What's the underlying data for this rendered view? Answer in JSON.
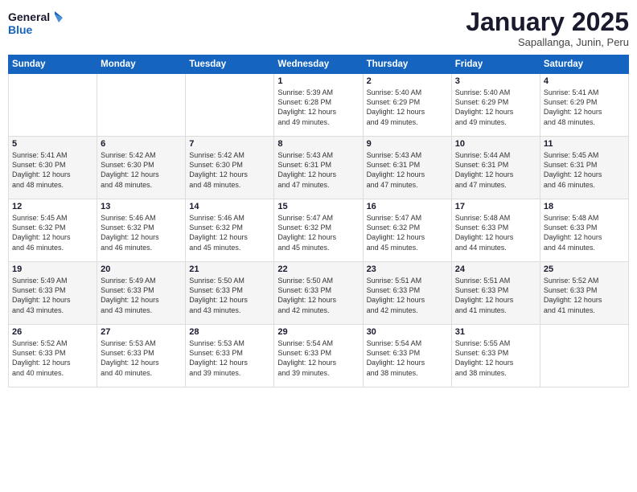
{
  "logo": {
    "line1": "General",
    "line2": "Blue"
  },
  "header": {
    "month": "January 2025",
    "location": "Sapallanga, Junin, Peru"
  },
  "weekdays": [
    "Sunday",
    "Monday",
    "Tuesday",
    "Wednesday",
    "Thursday",
    "Friday",
    "Saturday"
  ],
  "weeks": [
    [
      {
        "day": "",
        "info": ""
      },
      {
        "day": "",
        "info": ""
      },
      {
        "day": "",
        "info": ""
      },
      {
        "day": "1",
        "info": "Sunrise: 5:39 AM\nSunset: 6:28 PM\nDaylight: 12 hours\nand 49 minutes."
      },
      {
        "day": "2",
        "info": "Sunrise: 5:40 AM\nSunset: 6:29 PM\nDaylight: 12 hours\nand 49 minutes."
      },
      {
        "day": "3",
        "info": "Sunrise: 5:40 AM\nSunset: 6:29 PM\nDaylight: 12 hours\nand 49 minutes."
      },
      {
        "day": "4",
        "info": "Sunrise: 5:41 AM\nSunset: 6:29 PM\nDaylight: 12 hours\nand 48 minutes."
      }
    ],
    [
      {
        "day": "5",
        "info": "Sunrise: 5:41 AM\nSunset: 6:30 PM\nDaylight: 12 hours\nand 48 minutes."
      },
      {
        "day": "6",
        "info": "Sunrise: 5:42 AM\nSunset: 6:30 PM\nDaylight: 12 hours\nand 48 minutes."
      },
      {
        "day": "7",
        "info": "Sunrise: 5:42 AM\nSunset: 6:30 PM\nDaylight: 12 hours\nand 48 minutes."
      },
      {
        "day": "8",
        "info": "Sunrise: 5:43 AM\nSunset: 6:31 PM\nDaylight: 12 hours\nand 47 minutes."
      },
      {
        "day": "9",
        "info": "Sunrise: 5:43 AM\nSunset: 6:31 PM\nDaylight: 12 hours\nand 47 minutes."
      },
      {
        "day": "10",
        "info": "Sunrise: 5:44 AM\nSunset: 6:31 PM\nDaylight: 12 hours\nand 47 minutes."
      },
      {
        "day": "11",
        "info": "Sunrise: 5:45 AM\nSunset: 6:31 PM\nDaylight: 12 hours\nand 46 minutes."
      }
    ],
    [
      {
        "day": "12",
        "info": "Sunrise: 5:45 AM\nSunset: 6:32 PM\nDaylight: 12 hours\nand 46 minutes."
      },
      {
        "day": "13",
        "info": "Sunrise: 5:46 AM\nSunset: 6:32 PM\nDaylight: 12 hours\nand 46 minutes."
      },
      {
        "day": "14",
        "info": "Sunrise: 5:46 AM\nSunset: 6:32 PM\nDaylight: 12 hours\nand 45 minutes."
      },
      {
        "day": "15",
        "info": "Sunrise: 5:47 AM\nSunset: 6:32 PM\nDaylight: 12 hours\nand 45 minutes."
      },
      {
        "day": "16",
        "info": "Sunrise: 5:47 AM\nSunset: 6:32 PM\nDaylight: 12 hours\nand 45 minutes."
      },
      {
        "day": "17",
        "info": "Sunrise: 5:48 AM\nSunset: 6:33 PM\nDaylight: 12 hours\nand 44 minutes."
      },
      {
        "day": "18",
        "info": "Sunrise: 5:48 AM\nSunset: 6:33 PM\nDaylight: 12 hours\nand 44 minutes."
      }
    ],
    [
      {
        "day": "19",
        "info": "Sunrise: 5:49 AM\nSunset: 6:33 PM\nDaylight: 12 hours\nand 43 minutes."
      },
      {
        "day": "20",
        "info": "Sunrise: 5:49 AM\nSunset: 6:33 PM\nDaylight: 12 hours\nand 43 minutes."
      },
      {
        "day": "21",
        "info": "Sunrise: 5:50 AM\nSunset: 6:33 PM\nDaylight: 12 hours\nand 43 minutes."
      },
      {
        "day": "22",
        "info": "Sunrise: 5:50 AM\nSunset: 6:33 PM\nDaylight: 12 hours\nand 42 minutes."
      },
      {
        "day": "23",
        "info": "Sunrise: 5:51 AM\nSunset: 6:33 PM\nDaylight: 12 hours\nand 42 minutes."
      },
      {
        "day": "24",
        "info": "Sunrise: 5:51 AM\nSunset: 6:33 PM\nDaylight: 12 hours\nand 41 minutes."
      },
      {
        "day": "25",
        "info": "Sunrise: 5:52 AM\nSunset: 6:33 PM\nDaylight: 12 hours\nand 41 minutes."
      }
    ],
    [
      {
        "day": "26",
        "info": "Sunrise: 5:52 AM\nSunset: 6:33 PM\nDaylight: 12 hours\nand 40 minutes."
      },
      {
        "day": "27",
        "info": "Sunrise: 5:53 AM\nSunset: 6:33 PM\nDaylight: 12 hours\nand 40 minutes."
      },
      {
        "day": "28",
        "info": "Sunrise: 5:53 AM\nSunset: 6:33 PM\nDaylight: 12 hours\nand 39 minutes."
      },
      {
        "day": "29",
        "info": "Sunrise: 5:54 AM\nSunset: 6:33 PM\nDaylight: 12 hours\nand 39 minutes."
      },
      {
        "day": "30",
        "info": "Sunrise: 5:54 AM\nSunset: 6:33 PM\nDaylight: 12 hours\nand 38 minutes."
      },
      {
        "day": "31",
        "info": "Sunrise: 5:55 AM\nSunset: 6:33 PM\nDaylight: 12 hours\nand 38 minutes."
      },
      {
        "day": "",
        "info": ""
      }
    ]
  ]
}
